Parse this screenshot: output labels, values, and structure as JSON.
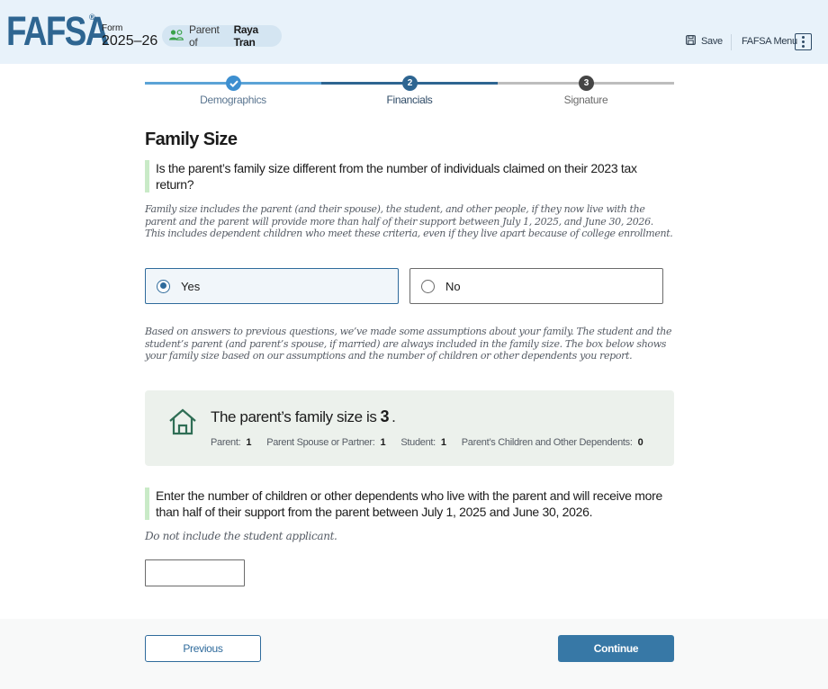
{
  "header": {
    "logo": "FAFSA",
    "logo_mark": "®",
    "form_label": "Form",
    "form_year": "2025–26",
    "role_prefix": "Parent of",
    "role_name": "Raya Tran",
    "save_label": "Save",
    "menu_label": "FAFSA Menu",
    "icons": {
      "role": "users-icon",
      "save": "save-icon",
      "menu": "kebab-menu-icon"
    }
  },
  "stepper": {
    "steps": [
      {
        "number": "1",
        "label": "Demographics",
        "status": "complete"
      },
      {
        "number": "2",
        "label": "Financials",
        "status": "current"
      },
      {
        "number": "3",
        "label": "Signature",
        "status": "upcoming"
      }
    ],
    "colors": {
      "complete": "#5ba3d6",
      "current": "#2e6591",
      "upcoming": "#bdbdbd",
      "upcoming_dot": "#454545"
    }
  },
  "page": {
    "title": "Family Size",
    "question1": "Is the parent’s family size different from the number of individuals claimed on their 2023 tax return?",
    "hint1": "Family size includes the parent (and their spouse), the student, and other people, if they now live with the parent and the parent will provide more than half of their support between July 1, 2025, and June 30, 2026. This includes dependent children who meet these criteria, even if they live apart because of college enrollment.",
    "options": [
      {
        "label": "Yes",
        "selected": true
      },
      {
        "label": "No",
        "selected": false
      }
    ],
    "assumption_text": "Based on answers to previous questions, we’ve made some assumptions about your family. The student and the student’s parent (and parent’s spouse, if married) are always included in the family size. The box below shows your family size based on our assumptions and the number of children or other dependents you report.",
    "family_size": {
      "prefix": "The parent’s family size is",
      "value": "3",
      "suffix": ".",
      "icon": "house-icon",
      "breakdown": [
        {
          "label": "Parent:",
          "value": "1"
        },
        {
          "label": "Parent Spouse or Partner:",
          "value": "1"
        },
        {
          "label": "Student:",
          "value": "1"
        },
        {
          "label": "Parent’s Children and Other Dependents:",
          "value": "0"
        }
      ]
    },
    "question2": "Enter the number of children or other dependents who live with the parent and will receive more than half of their support from the parent between July 1, 2025 and June 30, 2026.",
    "hint2": "Do not include the student applicant.",
    "dependents_input": {
      "value": "",
      "placeholder": ""
    }
  },
  "footer": {
    "previous_label": "Previous",
    "continue_label": "Continue"
  },
  "colors": {
    "brand": "#2e6591",
    "primary_button": "#3778a6",
    "question_accent": "#c9eac7",
    "summary_bg": "#ecf1ec",
    "header_bg": "#e8f2fa"
  }
}
